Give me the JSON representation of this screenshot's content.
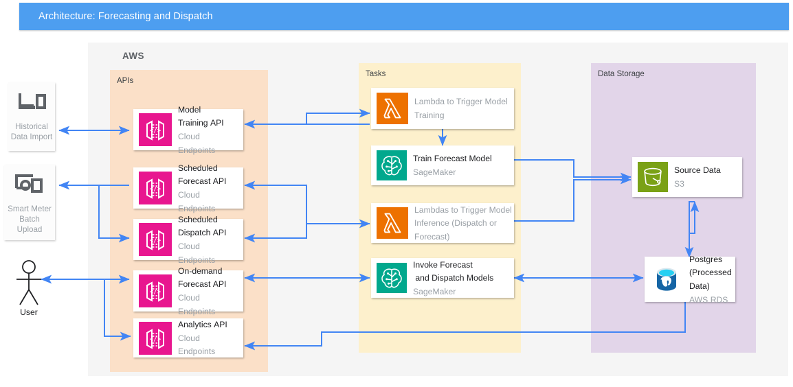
{
  "header": {
    "title": "Architecture: Forecasting and Dispatch",
    "bar_color": "#4d9ef0"
  },
  "cloud": {
    "label": "AWS"
  },
  "groups": [
    {
      "key": "apis",
      "label": "APIs",
      "color": "#fbe0c8"
    },
    {
      "key": "tasks",
      "label": "Tasks",
      "color": "#fdf0cc"
    },
    {
      "key": "storage",
      "label": "Data Storage",
      "color": "#e2d5e9"
    }
  ],
  "external": [
    {
      "key": "historical",
      "icon": "device-import-icon",
      "caption": "Historical\nData Import"
    },
    {
      "key": "smart_meter",
      "icon": "smart-meter-icon",
      "caption": "Smart Meter\nBatch\nUpload"
    }
  ],
  "actor": {
    "key": "user",
    "icon": "stick-figure-icon",
    "caption": "User"
  },
  "apis": [
    {
      "key": "model_training",
      "icon": "cloud-endpoints-icon",
      "title": "Model\nTraining API",
      "sub": "Cloud Endpoints",
      "dim": false
    },
    {
      "key": "scheduled_forecast",
      "icon": "cloud-endpoints-icon",
      "title": "Scheduled\nForecast API",
      "sub": "Cloud Endpoints",
      "dim": false
    },
    {
      "key": "scheduled_dispatch",
      "icon": "cloud-endpoints-icon",
      "title": "Scheduled\nDispatch API",
      "sub": "Cloud Endpoints",
      "dim": false
    },
    {
      "key": "ondemand_forecast",
      "icon": "cloud-endpoints-icon",
      "title": "On-demand\nForecast API",
      "sub": "Cloud Endpoints",
      "dim": false
    },
    {
      "key": "analytics",
      "icon": "cloud-endpoints-icon",
      "title": "Analytics API",
      "sub": "Cloud Endpoints",
      "dim": false
    }
  ],
  "tasks": [
    {
      "key": "lambda_training",
      "icon": "lambda-icon",
      "title": "Lambda to Trigger Model\nTraining",
      "sub": "",
      "dim": true
    },
    {
      "key": "train_forecast",
      "icon": "sagemaker-icon",
      "title": "Train Forecast Model",
      "sub": "SageMaker",
      "dim": false
    },
    {
      "key": "lambda_inference",
      "icon": "lambda-icon",
      "title": "Lambdas to Trigger Model\nInference (Dispatch or\nForecast)",
      "sub": "",
      "dim": true
    },
    {
      "key": "invoke_models",
      "icon": "sagemaker-icon",
      "title": "Invoke Forecast\n and Dispatch Models",
      "sub": "SageMaker",
      "dim": false
    }
  ],
  "storage": [
    {
      "key": "source_data",
      "icon": "s3-bucket-icon",
      "title": "Source Data",
      "sub": "S3",
      "dim": false
    },
    {
      "key": "postgres",
      "icon": "postgres-icon",
      "title": "Postgres\n(Processed\nData)",
      "sub": "AWS RDS",
      "dim": false
    }
  ],
  "colors": {
    "arrow": "#4285f4",
    "endpoints_pink": "#e8168f",
    "lambda_orange": "#ed7100",
    "sagemaker_teal": "#01a88d",
    "s3_green": "#7aa116",
    "postgres_blue": "#1565a5"
  }
}
